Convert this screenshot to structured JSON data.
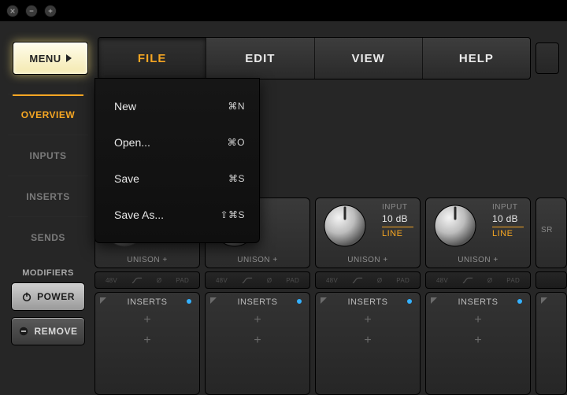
{
  "window_buttons": [
    "close",
    "minimize",
    "maximize"
  ],
  "menu_button": {
    "label": "MENU"
  },
  "tabs": [
    {
      "label": "FILE",
      "active": true
    },
    {
      "label": "EDIT",
      "active": false
    },
    {
      "label": "VIEW",
      "active": false
    },
    {
      "label": "HELP",
      "active": false
    }
  ],
  "sidebar": {
    "items": [
      {
        "label": "OVERVIEW",
        "active": true
      },
      {
        "label": "INPUTS",
        "active": false
      },
      {
        "label": "INSERTS",
        "active": false
      },
      {
        "label": "SENDS",
        "active": false
      }
    ],
    "modifiers_header": "MODIFIERS",
    "power_label": "POWER",
    "remove_label": "REMOVE"
  },
  "dropdown": {
    "items": [
      {
        "label": "New",
        "shortcut": "⌘N"
      },
      {
        "label": "Open...",
        "shortcut": "⌘O"
      },
      {
        "label": "Save",
        "shortcut": "⌘S"
      },
      {
        "label": "Save As...",
        "shortcut": "⇧⌘S"
      }
    ]
  },
  "channel": {
    "input_label": "INPUT",
    "gain": "10 dB",
    "line": "LINE",
    "unison": "UNISON +",
    "opt_48v": "48V",
    "opt_phase": "Ø",
    "opt_pad": "PAD",
    "inserts_title": "INSERTS",
    "plus": "+"
  },
  "sr_label": "SR"
}
